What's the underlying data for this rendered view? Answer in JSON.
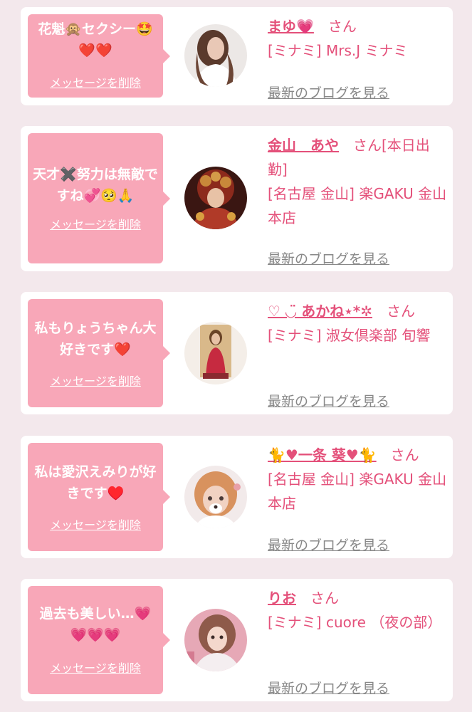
{
  "cards": [
    {
      "message": "花魁🙊セクシー🤩❤️❤️",
      "delete_label": "メッセージを削除",
      "name": "まゆ💗",
      "name_suffix": "さん",
      "shop": "[ミナミ] Mrs.J ミナミ",
      "blog_label": "最新のブログを見る"
    },
    {
      "message": "天才✖️努力は無敵ですね💞🥺🙏",
      "delete_label": "メッセージを削除",
      "name": "金山　あや",
      "name_suffix": "さん[本日出勤]",
      "shop": "[名古屋 金山] 楽GAKU 金山本店",
      "blog_label": "最新のブログを見る"
    },
    {
      "message": "私もりょうちゃん大好きです❤️",
      "delete_label": "メッセージを削除",
      "name": "♡ ◡̈ あかね⋆*✲",
      "name_suffix": "さん",
      "shop": "[ミナミ] 淑女倶楽部 旬響",
      "blog_label": "最新のブログを見る"
    },
    {
      "message": "私は愛沢えみりが好きです♥️",
      "delete_label": "メッセージを削除",
      "name": "🐈♥一条 葵♥🐈",
      "name_suffix": "さん",
      "shop": "[名古屋 金山] 楽GAKU 金山本店",
      "blog_label": "最新のブログを見る"
    },
    {
      "message": "過去も美しい…💗💗💗💗",
      "delete_label": "メッセージを削除",
      "name": "りお",
      "name_suffix": "さん",
      "shop": "[ミナミ] cuore （夜の部）",
      "blog_label": "最新のブログを見る"
    }
  ]
}
